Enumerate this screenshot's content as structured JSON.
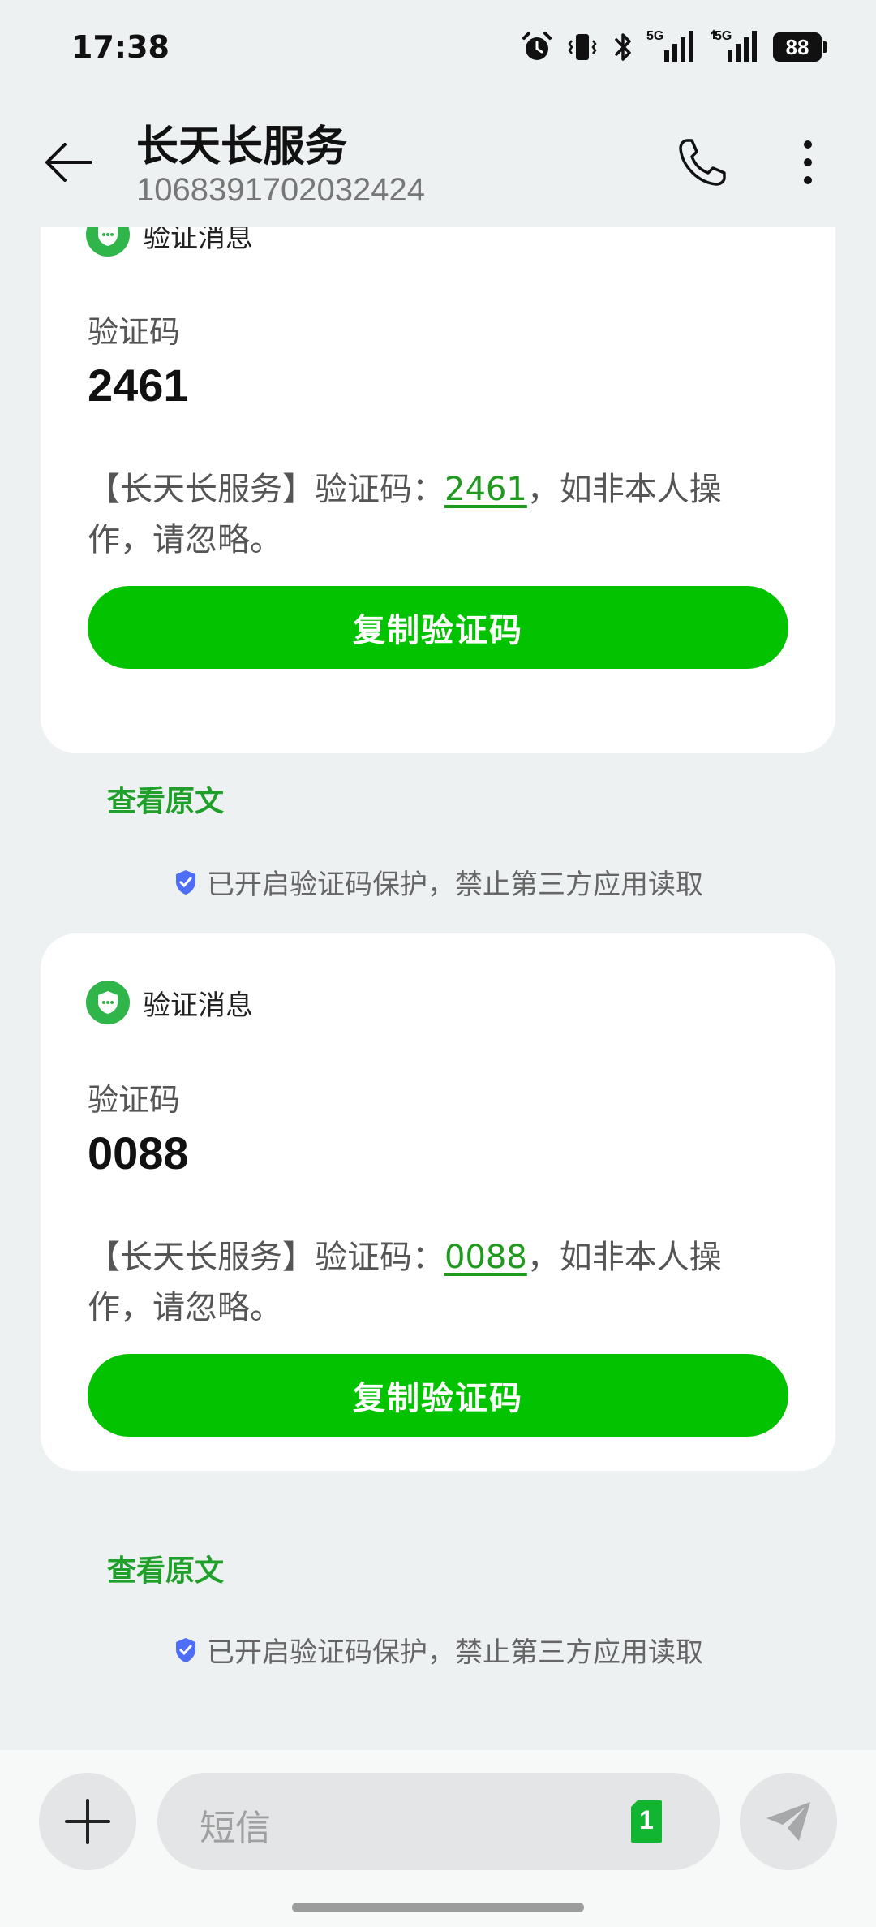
{
  "status_bar": {
    "time": "17:38",
    "network_1": "5G",
    "network_2": "5G",
    "battery": "88"
  },
  "header": {
    "title": "长天长服务",
    "number": "1068391702032424"
  },
  "messages": [
    {
      "tag": "验证消息",
      "code_label": "验证码",
      "code": "2461",
      "text_before": "【长天长服务】验证码：",
      "text_after": "，如非本人操作，请忽略。",
      "copy_label": "复制验证码",
      "view_original": "查看原文",
      "protection_note": "已开启验证码保护，禁止第三方应用读取"
    },
    {
      "tag": "验证消息",
      "code_label": "验证码",
      "code": "0088",
      "text_before": "【长天长服务】验证码：",
      "text_after": "，如非本人操作，请忽略。",
      "copy_label": "复制验证码",
      "view_original": "查看原文",
      "protection_note": "已开启验证码保护，禁止第三方应用读取"
    }
  ],
  "composer": {
    "placeholder": "短信",
    "sim_slot": "1"
  },
  "colors": {
    "accent_green": "#03c200",
    "link_green": "#1f9a1f",
    "background": "#edf1f2"
  },
  "icons": [
    "back-arrow-icon",
    "phone-icon",
    "more-vertical-icon",
    "alarm-icon",
    "vibrate-icon",
    "bluetooth-icon",
    "signal-icon",
    "battery-icon",
    "shield-message-icon",
    "shield-check-icon",
    "plus-icon",
    "sim-card-icon",
    "send-icon"
  ]
}
